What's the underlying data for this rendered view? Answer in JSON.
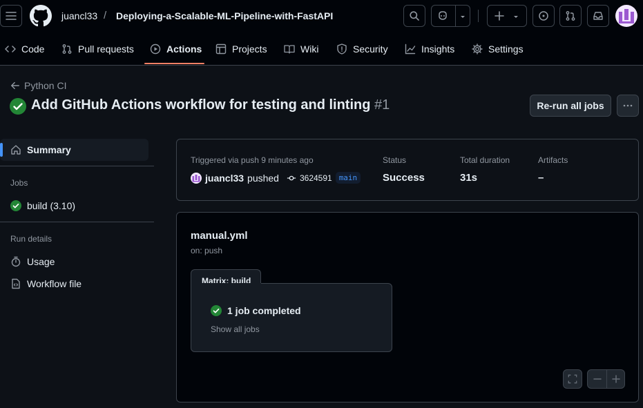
{
  "header": {
    "owner": "juancl33",
    "separator": "/",
    "repo": "Deploying-a-Scalable-ML-Pipeline-with-FastAPI"
  },
  "nav": {
    "tabs": [
      {
        "label": "Code",
        "icon": "code-icon"
      },
      {
        "label": "Pull requests",
        "icon": "pull-request-icon"
      },
      {
        "label": "Actions",
        "icon": "play-icon",
        "active": true
      },
      {
        "label": "Projects",
        "icon": "table-icon"
      },
      {
        "label": "Wiki",
        "icon": "book-icon"
      },
      {
        "label": "Security",
        "icon": "shield-icon"
      },
      {
        "label": "Insights",
        "icon": "graph-icon"
      },
      {
        "label": "Settings",
        "icon": "gear-icon"
      }
    ]
  },
  "run": {
    "back_label": "Python CI",
    "title": "Add GitHub Actions workflow for testing and linting",
    "number": "#1",
    "rerun_label": "Re-run all jobs"
  },
  "sidebar": {
    "summary_label": "Summary",
    "jobs_heading": "Jobs",
    "job_label": "build (3.10)",
    "run_details_heading": "Run details",
    "usage_label": "Usage",
    "workflow_file_label": "Workflow file"
  },
  "summary": {
    "triggered": "Triggered via push 9 minutes ago",
    "actor": "juancl33",
    "action": "pushed",
    "commit": "3624591",
    "branch": "main",
    "status_label": "Status",
    "status_value": "Success",
    "duration_label": "Total duration",
    "duration_value": "31s",
    "artifacts_label": "Artifacts",
    "artifacts_value": "–"
  },
  "workflow": {
    "file": "manual.yml",
    "trigger": "on: push",
    "matrix_label": "Matrix: build",
    "jobs_completed": "1 job completed",
    "show_all": "Show all jobs"
  },
  "colors": {
    "success": "#238636",
    "accent_underline": "#f78166",
    "link": "#4493f8"
  }
}
